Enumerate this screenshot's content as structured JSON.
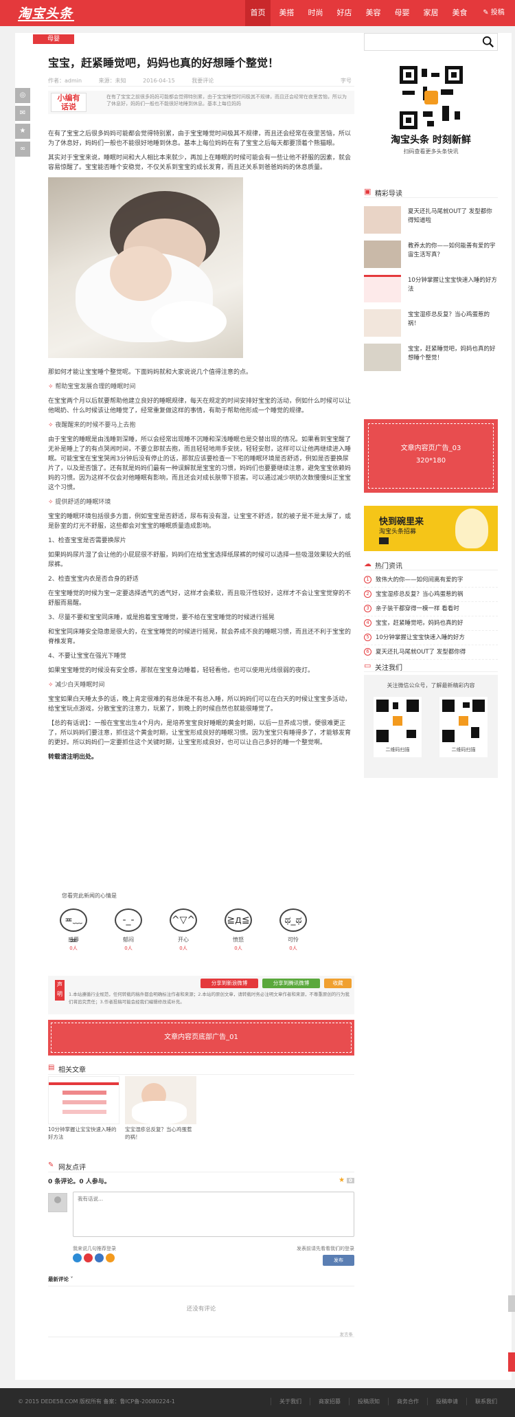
{
  "header": {
    "logo": "淘宝头条",
    "nav": [
      "首页",
      "美搭",
      "时尚",
      "好店",
      "美容",
      "母婴",
      "家居",
      "美食"
    ],
    "active": "首页",
    "submit": "投稿"
  },
  "share": {
    "icons": [
      "qzone-icon",
      "wechat-icon",
      "star-icon",
      "link-icon"
    ],
    "glyphs": [
      "◎",
      "✉",
      "★",
      "∞"
    ]
  },
  "article": {
    "category": "母婴",
    "title": "宝宝，赶紧睡觉吧，妈妈也真的好想睡个整觉！",
    "meta": {
      "author": "作者：admin",
      "source": "来源：未知",
      "date": "2016-04-15",
      "comments": "我要评论",
      "fontsize": "字号"
    },
    "editor": {
      "tag_line1": "小编有",
      "tag_line2": "话说",
      "summary": "在有了宝宝之前很多妈妈可能都会觉得特别累，由于宝宝睡觉时间极其不规律，而且还会经常在夜里苦恼，所以为了休息好，妈妈们一般也不能很好地睡到休息。基本上每位妈妈"
    },
    "paragraphs": [
      "在有了宝宝之后很多妈妈可能都会觉得特别累，由于宝宝睡觉时间极其不规律，而且还会经常在夜里苦恼，所以为了休息好，妈妈们一般也不能很好地睡到休息。基本上每位妈妈在有了宝宝之后每天都要顶着个熊猫眼。",
      "其实对于宝宝来说，睡眠时间和大人相比本来就少，再加上在睡眠的时候可能会有一些让他不舒服的因素，就会容易惊醒了。宝宝能否睡个安稳觉，不仅关系到宝宝的成长发育，而且还关系到爸爸妈妈的休息质量。",
      "那如何才能让宝宝睡个整觉呢。下面妈妈就和大家说说几个值得注意的点。"
    ],
    "sections": [
      {
        "h": "帮助宝宝发展合理的睡眠时间",
        "p": "在宝宝两个月以后就要帮助他建立良好的睡眠规律，每天在规定的时间安排好宝宝的活动，例如什么时候可以让他喝奶、什么时候该让他睡觉了，经常重复做这样的事情，有助于帮助他形成一个睡觉的规律。"
      },
      {
        "h": "夜醒醒来的时候不要马上去抱",
        "p": "由于宝宝的睡眠是由浅睡到深睡，所以会经常出现睡不沉睡和深浅睡眠也是交替出现的情况。如果看到宝宝醒了无补是睡上了的有点哭闹时间，不要立即就去抱，而且轻轻地用手安抚，轻轻安慰，这样可以让他再继续进入睡眠。可能宝宝在宝宝哭闹3分钟后没有停止的话，那就应该要检查一下宅的睡眠环境是否舒适，例如是否要换尿片了，以及是否饿了。还有就是妈妈们最有一种误解就是宝宝的习惯，妈妈们也要要继续注意，避免宝宝依赖妈妈的习惯。因为这样不仅会对他睡眠有影响，而且还会对成长肤带下损害。可以通过减少哄奶次数慢慢纠正宝宝这个习惯。"
      },
      {
        "h": "提供舒适的睡眠环境",
        "p": "宝宝的睡眠环境包括很多方面，例如宝宝是否舒适，尿布有没有湿，让宝宝不舒适，就的被子是不是太厚了，或是卧室的灯光不舒服，这些都会对宝宝的睡眠质量造成影响。"
      }
    ],
    "numbered": [
      {
        "h": "1、检查宝宝是否需要换尿片",
        "p": "如果妈妈尿片湿了会让他的小屁屁很不舒服，妈妈们在给宝宝选择纸尿裤的时候可以选择一些吸湿效果较大的纸尿裤。"
      },
      {
        "h": "2、检查宝宝内衣是否合身的舒适",
        "p": "在宝宝睡觉的时候为宝一定要选择透气的透气好，这样才会柔软，而且吸汗性较好，这样才不会让宝宝觉穿的不舒服而易醒。"
      },
      {
        "h": "3、尽量不要和宝宝同床睡，或是抱着宝宝睡觉，要不给在宝宝睡觉的时候进行摇晃",
        "p": "和宝宝同床睡安全隐患是很大的，在宝宝睡觉的时候进行摇晃，就会养成不良的睡眠习惯，而且还不利于宝宝的脊椎发育。"
      },
      {
        "h": "4、不要让宝宝在强光下睡觉",
        "p": "如果宝宝睡觉的时候没有安全感，那就在宝宝身边睡着，轻轻看他，也可以使用光线很弱的夜灯。"
      }
    ],
    "section4": {
      "h": "减少白天睡眠时间",
      "p": "宝宝如果白天睡太多的话，晚上肯定很难的有总体是不有总入睡，所以妈妈们可以在白天的时候让宝宝多活动，给宝宝玩点游戏，分散宝宝的注意力，玩累了，到晚上的时候自然也就能很睡觉了。"
    },
    "conclusion": "【总的有话说】：一般在宝宝出生4个月内，是培养宝宝良好睡眠的黄金时期，以后一旦养成习惯，便很难更正了，所以妈妈们要注意，抓住这个黄金时期，让宝宝形成良好的睡眠习惯。因为宝宝只有睡得多了，才能够发育的更好。所以妈妈们一定要抓住这个关键时期，让宝宝形成良好，也可以让自己多好的睡一个整觉啊。",
    "source_note": "转载请注明出处。"
  },
  "mood": {
    "question": "您看完此新闻的心情是",
    "items": [
      {
        "label": "感辱",
        "count": "0人",
        "face": "≖﹏≖"
      },
      {
        "label": "郁闷",
        "count": "0人",
        "face": "-_-"
      },
      {
        "label": "开心",
        "count": "0人",
        "face": "^▽^"
      },
      {
        "label": "愤怒",
        "count": "0人",
        "face": "≧д≦"
      },
      {
        "label": "可怜",
        "count": "0人",
        "face": "ಥ_ಥ"
      }
    ]
  },
  "declaration": {
    "tag": "声明",
    "text": "1.本站遵循行业规范，任何转载的稿件都会明确标注作者和来源；2.本站的原创文章，请转载时务必注明文章作者和来源，不尊重原创的行为我们将追究责任；3.作者投稿可能会经我们编辑修改或补充。",
    "btn_share": "分享到新浪微博",
    "btn_fav": "分享到腾讯微博",
    "btn_collect": "收藏"
  },
  "ad_bottom": "文章内容页底部广告_01",
  "related": {
    "title": "相关文章",
    "items": [
      {
        "caption": "10分钟掌握让宝宝快速入睡的好方法"
      },
      {
        "caption": "宝宝湿疹总反复？当心鸡蛋惹的祸！"
      }
    ]
  },
  "comments": {
    "title": "网友点评",
    "count_text": "0 条评论。0 人参与。",
    "score": "0",
    "placeholder": "我有话说...",
    "left_tip": "我来说几句推荐登录",
    "right_tip": "发表前请先看看我们的登录",
    "publish": "发布",
    "newest": "最新评论 ˅",
    "empty": "还没有评论",
    "footer_note": "发言条"
  },
  "sidebar": {
    "search_placeholder": "",
    "slogan": "淘宝头条 时刻新鲜",
    "slogan_sub": "扫码查看更多头条快讯",
    "featured_title": "精彩导读",
    "featured": [
      {
        "title": "夏天还扎马尾就OUT了 发型都你得知道啦"
      },
      {
        "title": "教养太的你——如何能善有爱的宇宙生活写真？"
      },
      {
        "title": "10分钟掌握让宝宝快速入睡的好方法"
      },
      {
        "title": "宝宝湿疹总反复？当心鸡蛋惹的祸！"
      },
      {
        "title": "宝宝，赶紧睡觉吧，妈妈也真的好想睡个整觉！"
      }
    ],
    "ad_right_title": "文章内容页广告_03",
    "ad_right_size": "320*180",
    "promo_a": "快到碗里来",
    "promo_b": "淘宝头条招募",
    "hot_title": "热门资讯",
    "hot": [
      "致伟大的你——如何间离有爱的字",
      "宝宝湿疹总反复？当心鸡蛋惹的祸",
      "亲子装干都穿得一模一样 看看时",
      "宝宝，赶紧睡觉吧，妈妈也真的好",
      "10分钟掌握让宝宝快速入睡的好方",
      "夏天还扎马尾就OUT了 发型都你得"
    ],
    "follow_title": "关注我们",
    "follow_text": "关注微信公众号，了解最新精彩内容",
    "qr_labels": [
      "二维码扫描",
      "二维码扫描"
    ]
  },
  "footer": {
    "copyright": "© 2015 DEDE58.COM 版权所有 备案：鲁ICP备-20080224-1",
    "links": [
      "关于我们",
      "商家招募",
      "投稿须知",
      "商务合作",
      "投稿申请",
      "联系我们"
    ]
  },
  "colors": {
    "brand": "#e4393c",
    "link": "#5a7eb3",
    "promo": "#f5c518"
  }
}
